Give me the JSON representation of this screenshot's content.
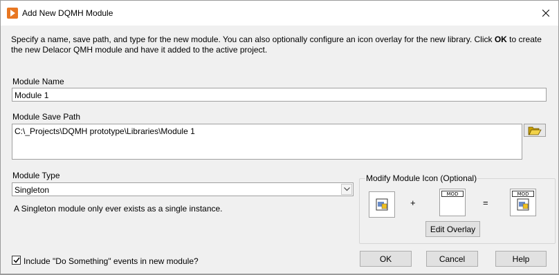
{
  "window": {
    "title": "Add New DQMH Module"
  },
  "description": {
    "before": "Specify a name, save path, and type for the new module. You can also optionally configure an icon overlay for the new library. Click ",
    "bold": "OK",
    "after": " to create the new Delacor QMH module and have it added to the active project."
  },
  "module_name": {
    "label": "Module Name",
    "value": "Module 1"
  },
  "save_path": {
    "label": "Module Save Path",
    "value": "C:\\_Projects\\DQMH prototype\\Libraries\\Module 1"
  },
  "module_type": {
    "label": "Module Type",
    "selected": "Singleton",
    "description": "A Singleton module only ever exists as a single instance."
  },
  "icon_group": {
    "title": "Modify Module Icon (Optional)",
    "plus": "+",
    "equals": "=",
    "mod_tag": "MOD",
    "edit_overlay_label": "Edit Overlay"
  },
  "checkbox": {
    "label": "Include \"Do Something\" events in new module?",
    "checked": true
  },
  "buttons": {
    "ok": "OK",
    "cancel": "Cancel",
    "help": "Help"
  },
  "colors": {
    "app_icon": "#e87722",
    "dialog_bg": "#f0f0f0"
  }
}
